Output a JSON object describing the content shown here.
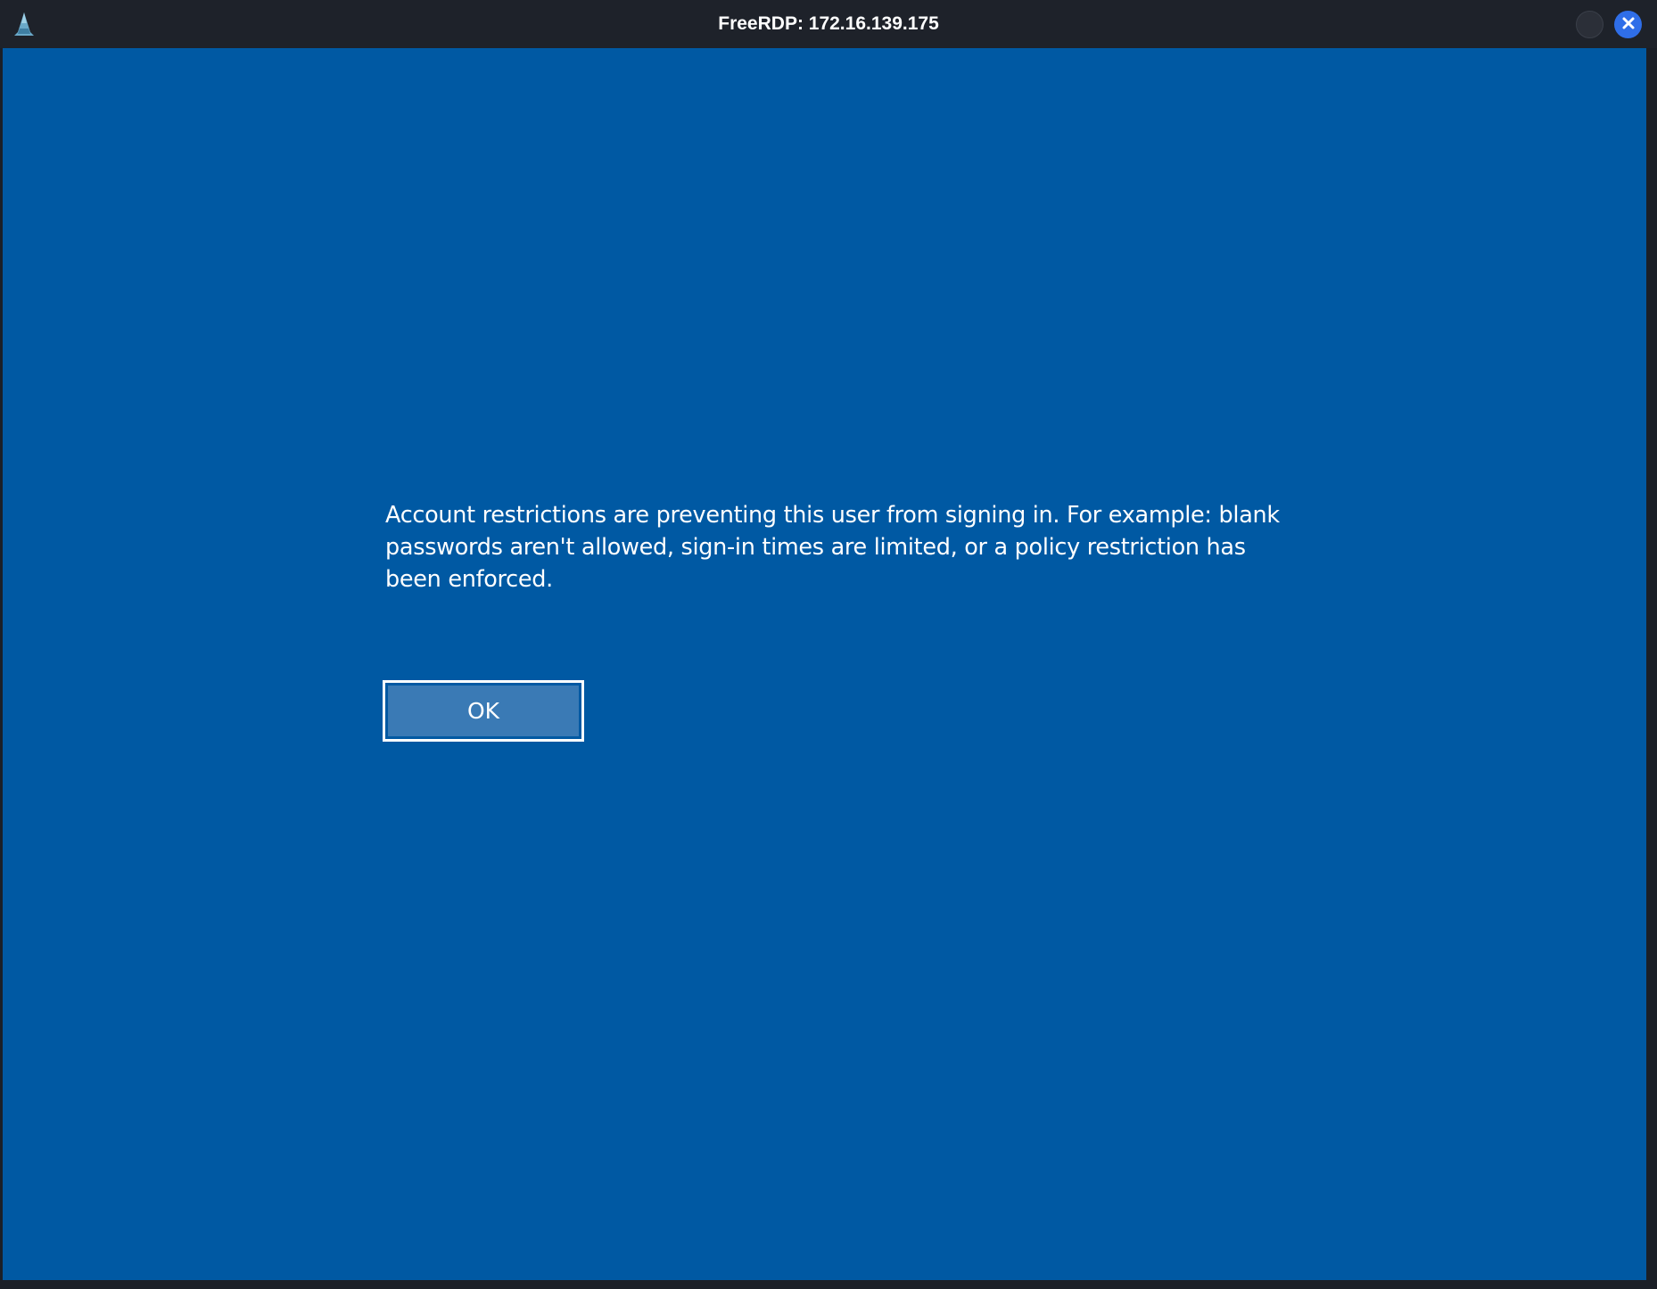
{
  "window": {
    "title": "FreeRDP: 172.16.139.175",
    "app_icon": "kali-dragon-icon",
    "controls": {
      "minimize_icon": "minimize-circle-icon",
      "close_icon": "close-icon"
    }
  },
  "dialog": {
    "message": "Account restrictions are preventing this user from signing in. For example: blank passwords aren't allowed, sign-in times are limited, or a policy restriction has been enforced.",
    "ok_label": "OK"
  },
  "colors": {
    "titlebar": "#1e222a",
    "remote_background": "#0059a3",
    "button_fill": "#3a7ab5",
    "close_button": "#2f6ee8"
  }
}
